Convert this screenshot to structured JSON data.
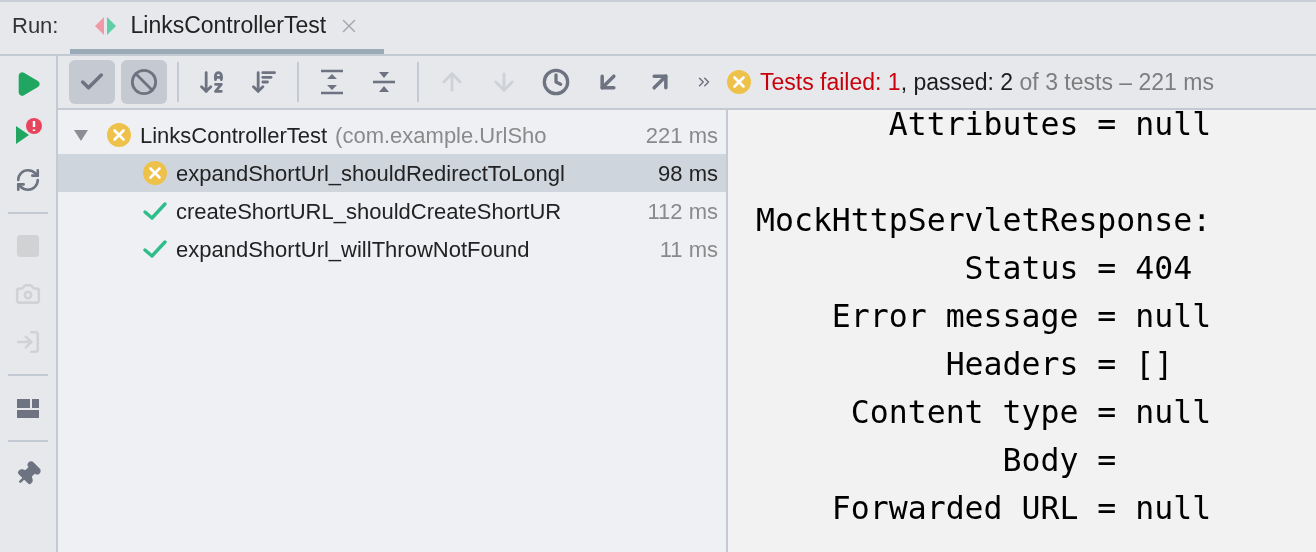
{
  "run_label": "Run:",
  "tab": {
    "title": "LinksControllerTest",
    "selected": true
  },
  "side_tools": [
    {
      "kind": "rerun",
      "disabled": false
    },
    {
      "kind": "rerun-failed",
      "disabled": false
    },
    {
      "kind": "auto-test",
      "disabled": false
    },
    {
      "kind": "separator"
    },
    {
      "kind": "stop",
      "disabled": true
    },
    {
      "kind": "camera",
      "disabled": true
    },
    {
      "kind": "import",
      "disabled": true
    },
    {
      "kind": "separator"
    },
    {
      "kind": "layout",
      "disabled": false
    },
    {
      "kind": "separator"
    },
    {
      "kind": "pin",
      "disabled": false
    }
  ],
  "toolbar": [
    {
      "kind": "show-passed",
      "selected": true,
      "disabled": false
    },
    {
      "kind": "show-ignored",
      "selected": true,
      "disabled": false
    },
    {
      "kind": "separator"
    },
    {
      "kind": "sort-alpha",
      "selected": false,
      "disabled": false
    },
    {
      "kind": "sort-duration",
      "selected": false,
      "disabled": false
    },
    {
      "kind": "separator"
    },
    {
      "kind": "expand-all",
      "selected": false,
      "disabled": false
    },
    {
      "kind": "collapse-all",
      "selected": false,
      "disabled": false
    },
    {
      "kind": "separator"
    },
    {
      "kind": "prev",
      "selected": false,
      "disabled": true
    },
    {
      "kind": "next",
      "selected": false,
      "disabled": true
    },
    {
      "kind": "history",
      "selected": false,
      "disabled": false
    },
    {
      "kind": "import",
      "selected": false,
      "disabled": false
    },
    {
      "kind": "export",
      "selected": false,
      "disabled": false
    },
    {
      "kind": "more",
      "selected": false,
      "disabled": false
    }
  ],
  "status": {
    "kind": "failed",
    "parts": [
      {
        "kind": "failed",
        "text": "Tests failed: 1"
      },
      {
        "kind": "passed",
        "text": ", passed: 2"
      },
      {
        "kind": "info",
        "text": " of 3 tests – 221 ms"
      }
    ]
  },
  "tree": {
    "name": "LinksControllerTest",
    "detail": "(com.example.UrlSho",
    "time": "221 ms",
    "kind": "failed",
    "expanded": true,
    "children": [
      {
        "name": "expandShortUrl_shouldRedirectToLongl",
        "time": "98 ms",
        "kind": "failed",
        "selected": true
      },
      {
        "name": "createShortURL_shouldCreateShortUR",
        "time": "112 ms",
        "kind": "passed",
        "selected": false
      },
      {
        "name": "expandShortUrl_willThrowNotFound",
        "time": "11 ms",
        "kind": "passed",
        "selected": false
      }
    ]
  },
  "console": {
    "blocks": [
      {
        "lines": [
          "       Attributes = null"
        ]
      },
      {
        "header": "MockHttpServletResponse:",
        "lines": [
          "           Status = 404",
          "    Error message = null",
          "          Headers = []",
          "     Content type = null",
          "             Body =",
          "    Forwarded URL = null"
        ]
      }
    ]
  }
}
